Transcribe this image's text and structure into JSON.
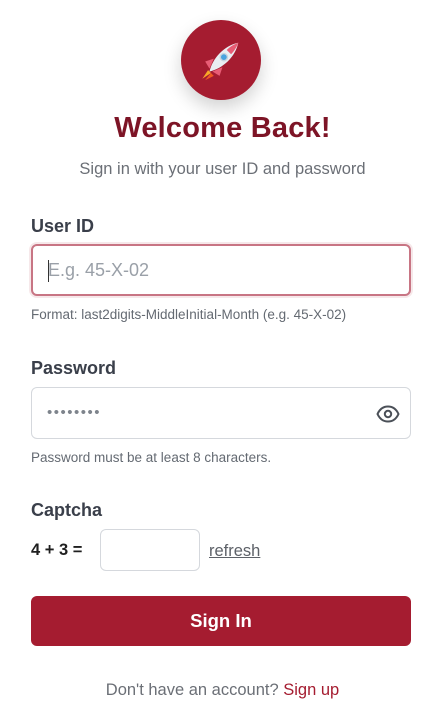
{
  "header": {
    "logo_icon": "rocket-icon",
    "title": "Welcome Back!",
    "subtitle": "Sign in with your user ID and password"
  },
  "user_id": {
    "label": "User ID",
    "value": "",
    "placeholder": "E.g. 45-X-02",
    "hint": "Format: last2digits-MiddleInitial-Month (e.g. 45-X-02)"
  },
  "password": {
    "label": "Password",
    "masked_value": "••••••••",
    "toggle_icon": "eye-icon",
    "hint": "Password must be at least 8 characters."
  },
  "captcha": {
    "label": "Captcha",
    "question": "4 + 3 =",
    "value": "",
    "refresh_label": "refresh"
  },
  "submit": {
    "label": "Sign In"
  },
  "footer": {
    "text": "Don't have an account?",
    "link_label": "Sign up"
  },
  "colors": {
    "brand": "#a51c30",
    "title": "#7d1426"
  }
}
